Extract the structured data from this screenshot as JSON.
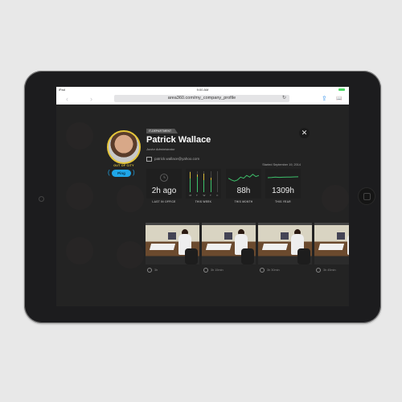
{
  "device": {
    "status_left": "iPad",
    "time": "9:00 AM"
  },
  "browser": {
    "back_icon": "‹",
    "forward_icon": "›",
    "url": "area360.com/my_company_profile",
    "reload_icon": "↻",
    "share_icon": "⇪",
    "bookmarks_icon": "📖"
  },
  "profile": {
    "department": "IT-DEPARTMENT",
    "name": "Patrick Wallace",
    "role": "Junior Administrator",
    "email": "patrick.wallace@yahoo.com",
    "status": "OUT OF CITY",
    "ping_label": "Ping",
    "started": "Started September 19, 2014",
    "close_icon": "✕",
    "status_color": "#e4c53a",
    "ping_color": "#1fa6e8"
  },
  "stats": [
    {
      "value": "2h ago",
      "caption": "LAST IN OFFICE",
      "icon": "clock-icon"
    },
    {
      "value": "",
      "caption": "THIS WEEK",
      "days": [
        "M",
        "T",
        "W",
        "T",
        "F"
      ],
      "fractions": [
        0.95,
        0.85,
        0.9,
        0.7,
        0.0
      ]
    },
    {
      "value": "88h",
      "caption": "THIS MONTH",
      "trend": [
        0.45,
        0.3,
        0.2,
        0.3,
        0.55,
        0.45,
        0.7,
        0.55,
        0.8,
        0.6,
        0.7
      ]
    },
    {
      "value": "1309h",
      "caption": "THIS YEAR",
      "trend": [
        0.5,
        0.52,
        0.55,
        0.53,
        0.54,
        0.56,
        0.55,
        0.57,
        0.58
      ]
    }
  ],
  "photos": [
    {
      "time": "3h"
    },
    {
      "time": "3h 15min"
    },
    {
      "time": "3h 30min"
    },
    {
      "time": "3h 45min"
    }
  ],
  "colors": {
    "accent_green": "#3dbf6a",
    "accent_yellow": "#d7b93a"
  }
}
